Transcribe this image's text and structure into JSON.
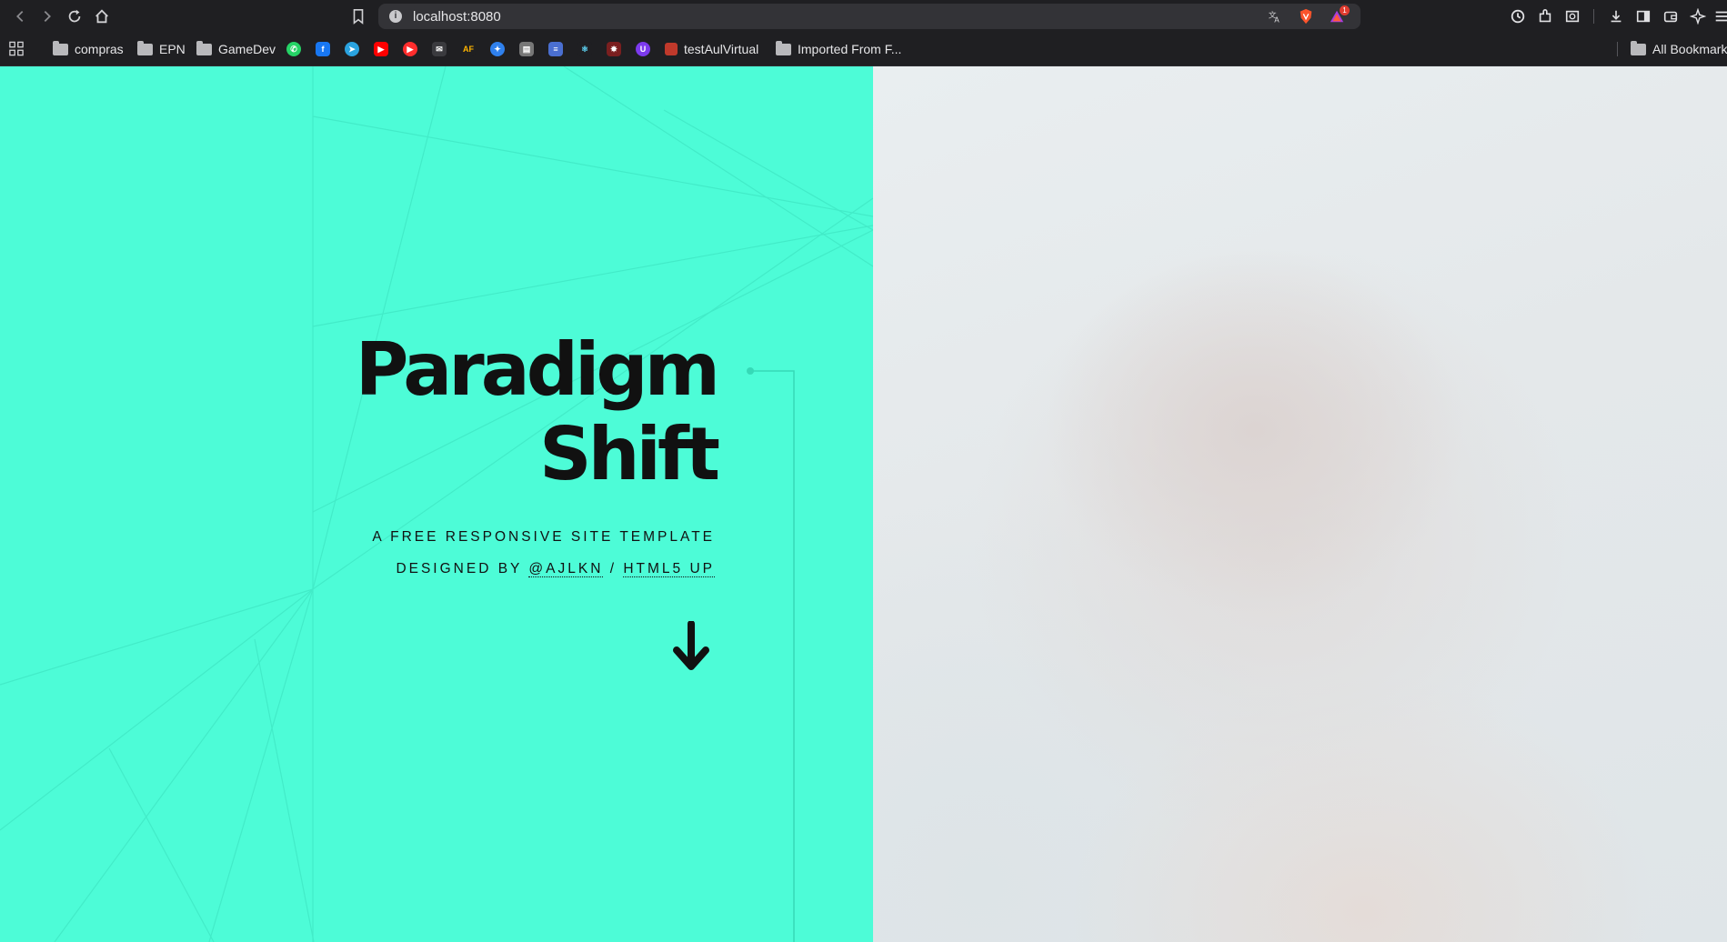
{
  "browser": {
    "url": "localhost:8080",
    "nav": [
      "back-icon",
      "forward-icon",
      "reload-icon",
      "home-icon"
    ],
    "bookmarks": [
      {
        "label": "compras",
        "type": "folder"
      },
      {
        "label": "EPN",
        "type": "folder"
      },
      {
        "label": "GameDev",
        "type": "folder"
      },
      {
        "label": "testAulVirtual",
        "type": "link"
      },
      {
        "label": "Imported From F...",
        "type": "folder"
      },
      {
        "label": "All Bookmarks",
        "type": "folder"
      }
    ],
    "notification_count": "1"
  },
  "page": {
    "title_line1": "Paradigm",
    "title_line2": "Shift",
    "tagline": "A FREE RESPONSIVE SITE TEMPLATE",
    "designed_by": "DESIGNED BY",
    "author_link": "@AJLKN",
    "separator": "/",
    "vendor_link": "HTML5 UP",
    "colors": {
      "accent": "#4dfcd7",
      "text": "#111111"
    }
  }
}
